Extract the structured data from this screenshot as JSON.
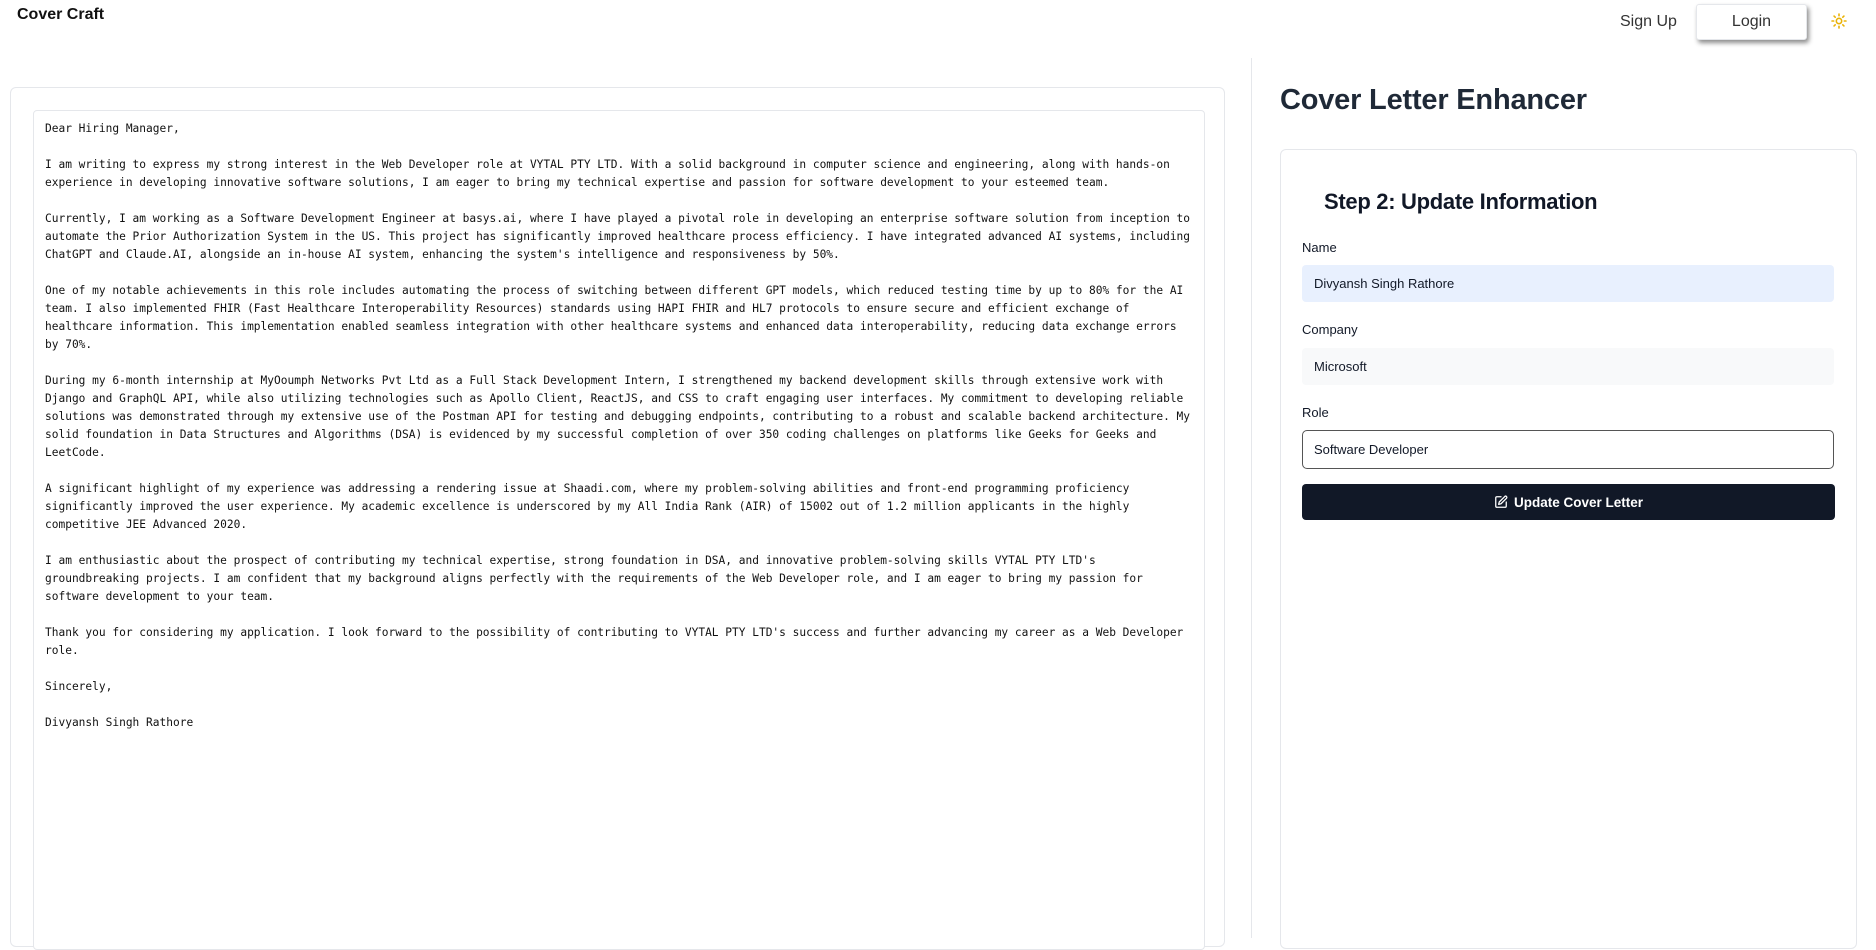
{
  "navbar": {
    "brand": "Cover Craft",
    "signup_label": "Sign Up",
    "login_label": "Login",
    "theme_icon": "sun-icon",
    "theme_icon_color": "#eab308"
  },
  "letter": {
    "text": "Dear Hiring Manager,\n\nI am writing to express my strong interest in the Web Developer role at VYTAL PTY LTD. With a solid background in computer science and engineering, along with hands-on experience in developing innovative software solutions, I am eager to bring my technical expertise and passion for software development to your esteemed team.\n\nCurrently, I am working as a Software Development Engineer at basys.ai, where I have played a pivotal role in developing an enterprise software solution from inception to automate the Prior Authorization System in the US. This project has significantly improved healthcare process efficiency. I have integrated advanced AI systems, including ChatGPT and Claude.AI, alongside an in-house AI system, enhancing the system's intelligence and responsiveness by 50%.\n\nOne of my notable achievements in this role includes automating the process of switching between different GPT models, which reduced testing time by up to 80% for the AI team. I also implemented FHIR (Fast Healthcare Interoperability Resources) standards using HAPI FHIR and HL7 protocols to ensure secure and efficient exchange of healthcare information. This implementation enabled seamless integration with other healthcare systems and enhanced data interoperability, reducing data exchange errors by 70%.\n\nDuring my 6-month internship at MyOoumph Networks Pvt Ltd as a Full Stack Development Intern, I strengthened my backend development skills through extensive work with Django and GraphQL API, while also utilizing technologies such as Apollo Client, ReactJS, and CSS to craft engaging user interfaces. My commitment to developing reliable solutions was demonstrated through my extensive use of the Postman API for testing and debugging endpoints, contributing to a robust and scalable backend architecture. My solid foundation in Data Structures and Algorithms (DSA) is evidenced by my successful completion of over 350 coding challenges on platforms like Geeks for Geeks and LeetCode.\n\nA significant highlight of my experience was addressing a rendering issue at Shaadi.com, where my problem-solving abilities and front-end programming proficiency significantly improved the user experience. My academic excellence is underscored by my All India Rank (AIR) of 15002 out of 1.2 million applicants in the highly competitive JEE Advanced 2020.\n\nI am enthusiastic about the prospect of contributing my technical expertise, strong foundation in DSA, and innovative problem-solving skills VYTAL PTY LTD's groundbreaking projects. I am confident that my background aligns perfectly with the requirements of the Web Developer role, and I am eager to bring my passion for software development to your team.\n\nThank you for considering my application. I look forward to the possibility of contributing to VYTAL PTY LTD's success and further advancing my career as a Web Developer role.\n\nSincerely,\n\nDivyansh Singh Rathore"
  },
  "enhancer": {
    "title": "Cover Letter Enhancer",
    "step_title": "Step 2: Update Information",
    "fields": {
      "name": {
        "label": "Name",
        "value": "Divyansh Singh Rathore"
      },
      "company": {
        "label": "Company",
        "value": "Microsoft"
      },
      "role": {
        "label": "Role",
        "value": "Software Developer"
      }
    },
    "submit_label": "Update Cover Letter",
    "submit_icon": "edit-icon"
  }
}
